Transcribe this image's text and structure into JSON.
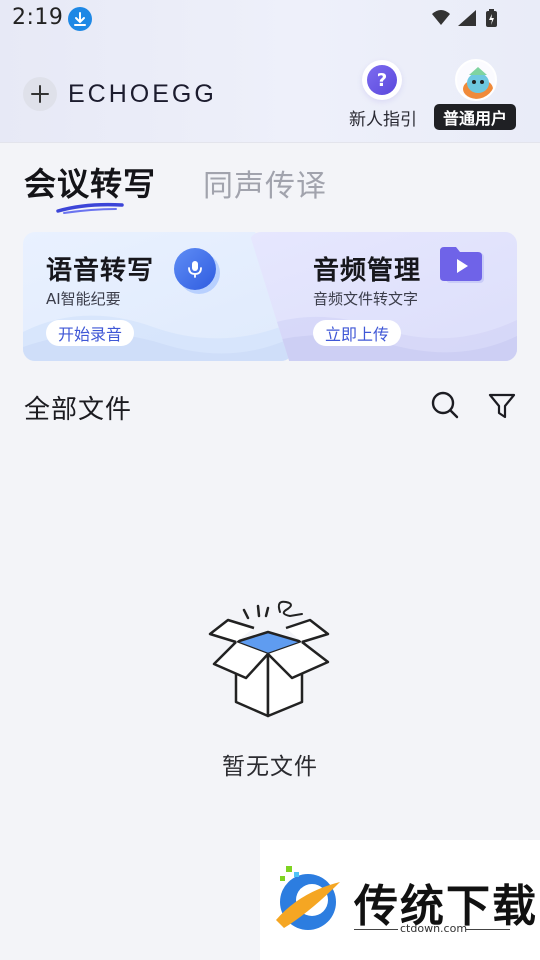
{
  "status_bar": {
    "time": "2:19",
    "icons": [
      "download-icon",
      "wifi-icon",
      "signal-icon",
      "battery-icon"
    ]
  },
  "header": {
    "logo_text": "ECHOEGG",
    "guide_label": "新人指引",
    "guide_icon_glyph": "?",
    "user_badge": "普通用户"
  },
  "tabs": [
    {
      "label": "会议转写",
      "active": true
    },
    {
      "label": "同声传译",
      "active": false
    }
  ],
  "cards": {
    "transcribe": {
      "title": "语音转写",
      "subtitle": "AI智能纪要",
      "button": "开始录音"
    },
    "audio": {
      "title": "音频管理",
      "subtitle": "音频文件转文字",
      "button": "立即上传"
    }
  },
  "files": {
    "title": "全部文件",
    "empty_text": "暂无文件"
  },
  "watermark": {
    "title": "传统下载",
    "url": "ctdown.com"
  },
  "colors": {
    "accent": "#3f57d6",
    "badge_bg": "#1f2024",
    "inactive_tab": "#a1a3ad"
  }
}
